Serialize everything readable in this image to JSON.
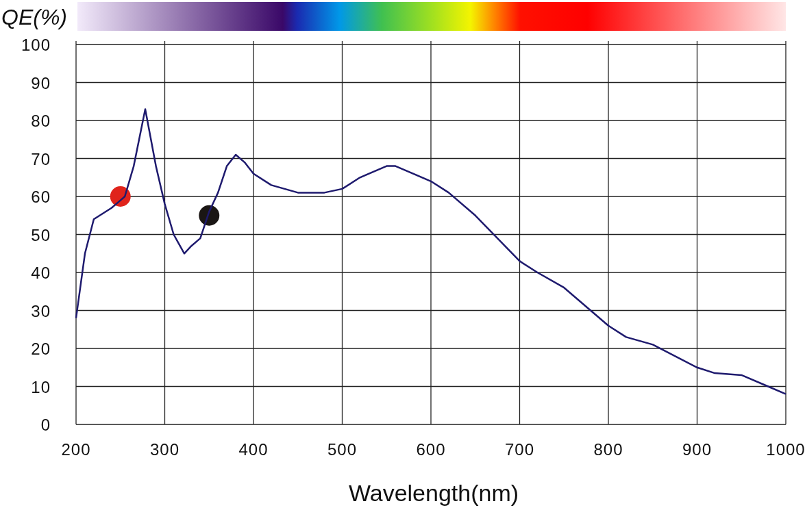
{
  "chart_data": {
    "type": "line",
    "ylabel": "QE(%)",
    "xlabel": "Wavelength(nm)",
    "grid": true,
    "x": [
      200,
      210,
      220,
      240,
      250,
      255,
      265,
      278,
      290,
      300,
      310,
      322,
      330,
      340,
      350,
      360,
      370,
      380,
      390,
      400,
      420,
      450,
      480,
      500,
      520,
      550,
      560,
      600,
      620,
      650,
      700,
      720,
      750,
      800,
      820,
      850,
      900,
      920,
      950,
      980,
      1000
    ],
    "series": [
      {
        "color": "#1e1a6e",
        "values": [
          28,
          45,
          54,
          57,
          59,
          60,
          68,
          83,
          68,
          58,
          50,
          45,
          47,
          49,
          56,
          61,
          68,
          71,
          69,
          66,
          63,
          61,
          61,
          62,
          65,
          68,
          68,
          64,
          61,
          55,
          43,
          40,
          36,
          26,
          23,
          21,
          15,
          13.5,
          13,
          10,
          8
        ]
      },
      {
        "type": "scatter",
        "color": "#e0241c",
        "values": [
          null,
          null,
          null,
          null,
          60,
          null,
          null,
          null,
          null,
          null,
          null,
          null,
          null,
          null,
          null,
          null,
          null,
          null,
          null,
          null,
          null,
          null,
          null,
          null,
          null,
          null,
          null,
          null,
          null,
          null,
          null,
          null,
          null,
          null,
          null,
          null,
          null,
          null,
          null,
          null,
          null
        ]
      },
      {
        "type": "scatter",
        "color": "#1a1614",
        "values": [
          null,
          null,
          null,
          null,
          null,
          null,
          null,
          null,
          null,
          null,
          null,
          null,
          null,
          null,
          55,
          null,
          null,
          null,
          null,
          null,
          null,
          null,
          null,
          null,
          null,
          null,
          null,
          null,
          null,
          null,
          null,
          null,
          null,
          null,
          null,
          null,
          null,
          null,
          null,
          null,
          null
        ]
      }
    ],
    "xlim": [
      200,
      1000
    ],
    "ylim": [
      0,
      100
    ],
    "xticks": [
      200,
      300,
      400,
      500,
      600,
      700,
      800,
      900,
      1000
    ],
    "yticks": [
      0,
      10,
      20,
      30,
      40,
      50,
      60,
      70,
      80,
      90,
      100
    ]
  }
}
